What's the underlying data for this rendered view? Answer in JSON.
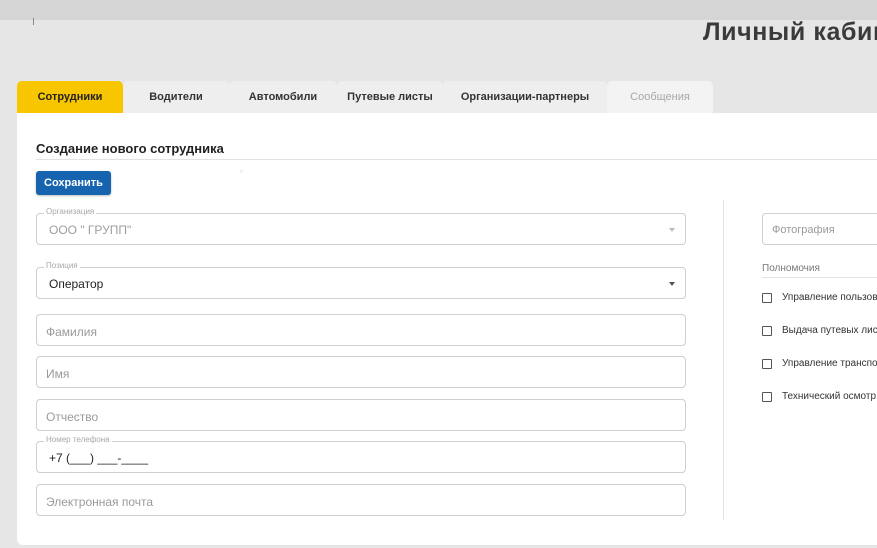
{
  "header": {
    "title": "Личный кабинет"
  },
  "tabs": [
    {
      "label": "Сотрудники",
      "state": "active"
    },
    {
      "label": "Водители",
      "state": "normal"
    },
    {
      "label": "Автомобили",
      "state": "normal"
    },
    {
      "label": "Путевые листы",
      "state": "normal"
    },
    {
      "label": "Организации-партнеры",
      "state": "normal"
    },
    {
      "label": "Сообщения",
      "state": "disabled"
    }
  ],
  "form": {
    "title": "Создание нового сотрудника",
    "save_label": "Сохранить",
    "organization": {
      "legend": "Организация",
      "value": "ООО \"    ГРУПП\""
    },
    "position": {
      "legend": "Позиция",
      "value": "Оператор"
    },
    "last_name": {
      "placeholder": "Фамилия"
    },
    "first_name": {
      "placeholder": "Имя"
    },
    "middle_name": {
      "placeholder": "Отчество"
    },
    "phone": {
      "legend": "Номер телефона",
      "value": "+7 (___) ___-____"
    },
    "email": {
      "placeholder": "Электронная почта"
    }
  },
  "sidebar": {
    "photo_placeholder": "Фотография",
    "permissions_title": "Полномочия",
    "permissions": [
      {
        "label": "Управление пользователями",
        "checked": false
      },
      {
        "label": "Выдача путевых листов",
        "checked": false
      },
      {
        "label": "Управление транспортом",
        "checked": false
      },
      {
        "label": "Технический осмотр",
        "checked": false
      }
    ]
  },
  "colors": {
    "accent_tab": "#f7c600",
    "primary_button": "#1663b0",
    "background": "#e6e6e6"
  }
}
